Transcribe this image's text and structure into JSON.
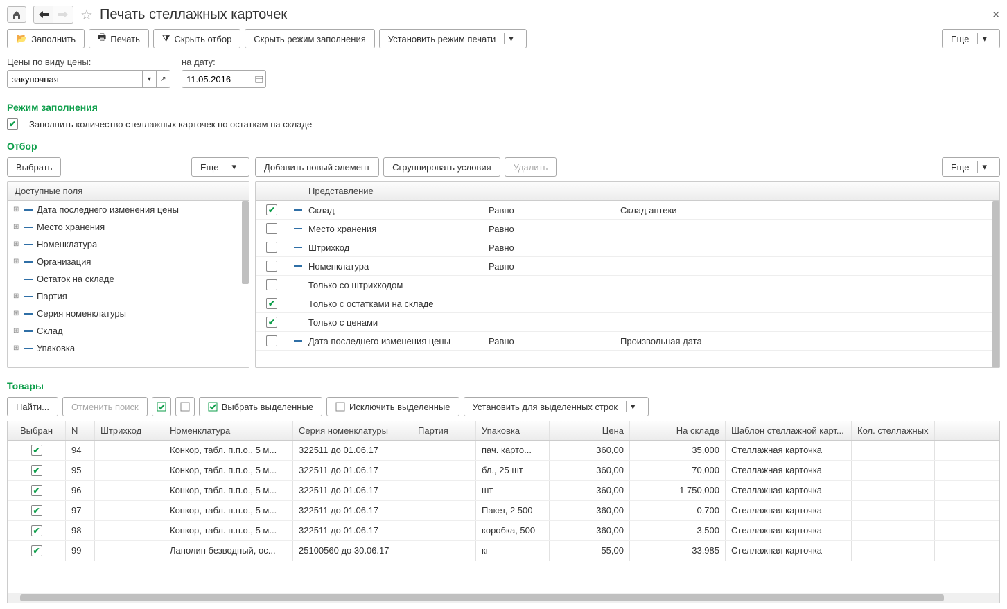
{
  "header": {
    "title": "Печать стеллажных карточек"
  },
  "toolbar": {
    "fill": "Заполнить",
    "print": "Печать",
    "hide_filter": "Скрыть отбор",
    "hide_fill_mode": "Скрыть режим заполнения",
    "set_print_mode": "Установить режим печати",
    "more": "Еще"
  },
  "form": {
    "price_label": "Цены по виду цены:",
    "price_value": "закупочная",
    "date_label": "на дату:",
    "date_value": "11.05.2016"
  },
  "fill_mode": {
    "title": "Режим заполнения",
    "option": "Заполнить количество стеллажных карточек по остаткам на складе"
  },
  "filter": {
    "title": "Отбор",
    "choose": "Выбрать",
    "more": "Еще",
    "add_new": "Добавить новый элемент",
    "group": "Сгруппировать условия",
    "delete": "Удалить",
    "more2": "Еще",
    "available_header": "Доступные поля",
    "repr_header": "Представление",
    "fields": [
      {
        "exp": true,
        "label": "Дата последнего изменения цены"
      },
      {
        "exp": true,
        "label": "Место хранения"
      },
      {
        "exp": true,
        "label": "Номенклатура"
      },
      {
        "exp": true,
        "label": "Организация"
      },
      {
        "exp": false,
        "label": "Остаток на складе"
      },
      {
        "exp": true,
        "label": "Партия"
      },
      {
        "exp": true,
        "label": "Серия номенклатуры"
      },
      {
        "exp": true,
        "label": "Склад"
      },
      {
        "exp": true,
        "label": "Упаковка"
      }
    ],
    "rows": [
      {
        "checked": true,
        "dash": true,
        "name": "Склад",
        "cond": "Равно",
        "val": "Склад аптеки"
      },
      {
        "checked": false,
        "dash": true,
        "name": "Место хранения",
        "cond": "Равно",
        "val": ""
      },
      {
        "checked": false,
        "dash": true,
        "name": "Штрихкод",
        "cond": "Равно",
        "val": ""
      },
      {
        "checked": false,
        "dash": true,
        "name": "Номенклатура",
        "cond": "Равно",
        "val": ""
      },
      {
        "checked": false,
        "dash": false,
        "name": "Только со штрихкодом",
        "cond": "",
        "val": ""
      },
      {
        "checked": true,
        "dash": false,
        "name": "Только с остатками на складе",
        "cond": "",
        "val": ""
      },
      {
        "checked": true,
        "dash": false,
        "name": "Только с ценами",
        "cond": "",
        "val": ""
      },
      {
        "checked": false,
        "dash": true,
        "name": "Дата последнего изменения цены",
        "cond": "Равно",
        "val": "Произвольная дата"
      }
    ]
  },
  "goods": {
    "title": "Товары",
    "find": "Найти...",
    "cancel_find": "Отменить поиск",
    "select_marked": "Выбрать выделенные",
    "exclude_marked": "Исключить выделенные",
    "set_for_marked": "Установить для выделенных строк",
    "columns": {
      "selected": "Выбран",
      "n": "N",
      "barcode": "Штрихкод",
      "nomen": "Номенклатура",
      "series": "Серия номенклатуры",
      "batch": "Партия",
      "pack": "Упаковка",
      "price": "Цена",
      "stock": "На складе",
      "template": "Шаблон стеллажной карт...",
      "qty": "Кол. стеллажных"
    },
    "rows": [
      {
        "sel": true,
        "n": "94",
        "nomen": "Конкор, табл. п.п.о., 5 м...",
        "series": "322511 до 01.06.17",
        "pack": "пач. карто...",
        "price": "360,00",
        "stock": "35,000",
        "tpl": "Стеллажная карточка"
      },
      {
        "sel": true,
        "n": "95",
        "nomen": "Конкор, табл. п.п.о., 5 м...",
        "series": "322511 до 01.06.17",
        "pack": "бл., 25 шт",
        "price": "360,00",
        "stock": "70,000",
        "tpl": "Стеллажная карточка"
      },
      {
        "sel": true,
        "n": "96",
        "nomen": "Конкор, табл. п.п.о., 5 м...",
        "series": "322511 до 01.06.17",
        "pack": "шт",
        "price": "360,00",
        "stock": "1 750,000",
        "tpl": "Стеллажная карточка"
      },
      {
        "sel": true,
        "n": "97",
        "nomen": "Конкор, табл. п.п.о., 5 м...",
        "series": "322511 до 01.06.17",
        "pack": "Пакет, 2 500",
        "price": "360,00",
        "stock": "0,700",
        "tpl": "Стеллажная карточка"
      },
      {
        "sel": true,
        "n": "98",
        "nomen": "Конкор, табл. п.п.о., 5 м...",
        "series": "322511 до 01.06.17",
        "pack": "коробка, 500",
        "price": "360,00",
        "stock": "3,500",
        "tpl": "Стеллажная карточка"
      },
      {
        "sel": true,
        "n": "99",
        "nomen": "Ланолин безводный, ос...",
        "series": "25100560 до 30.06.17",
        "pack": "кг",
        "price": "55,00",
        "stock": "33,985",
        "tpl": "Стеллажная карточка"
      }
    ]
  }
}
